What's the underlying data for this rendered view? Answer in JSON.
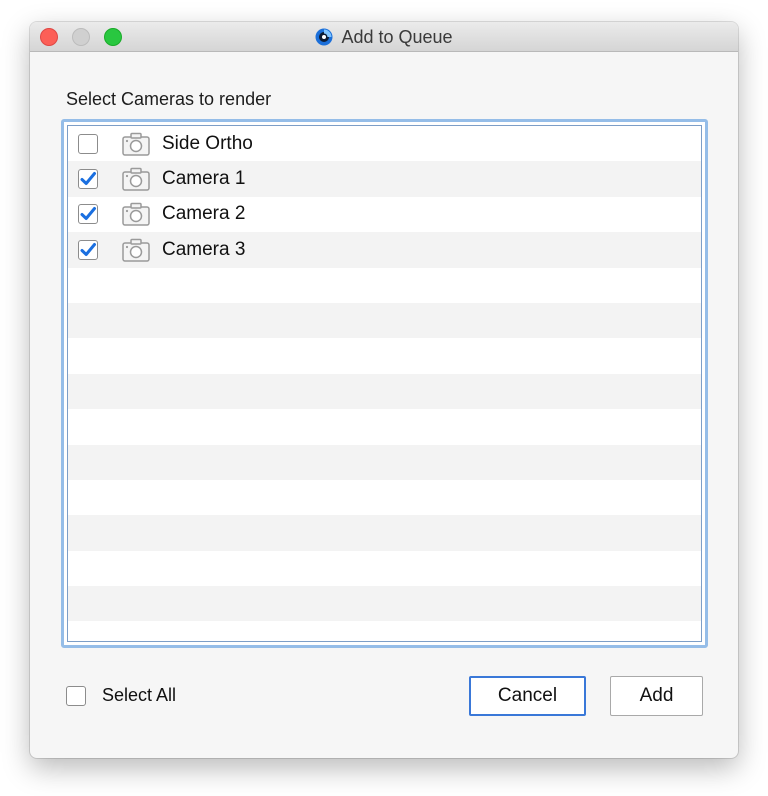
{
  "window": {
    "title": "Add to Queue"
  },
  "section_label": "Select Cameras to render",
  "cameras": [
    {
      "label": "Side Ortho",
      "checked": false,
      "icon": "camera-icon"
    },
    {
      "label": "Camera 1",
      "checked": true,
      "icon": "camera-icon"
    },
    {
      "label": "Camera 2",
      "checked": true,
      "icon": "camera-icon"
    },
    {
      "label": "Camera 3",
      "checked": true,
      "icon": "camera-icon"
    }
  ],
  "select_all": {
    "label": "Select All",
    "checked": false
  },
  "buttons": {
    "cancel_label": "Cancel",
    "add_label": "Add"
  },
  "colors": {
    "checkbox_check": "#1a6fe0",
    "list_focus_ring": "#95bde8",
    "default_button_border": "#3a78d8",
    "close_button": "#fc5f57",
    "maximize_button": "#29c740"
  }
}
